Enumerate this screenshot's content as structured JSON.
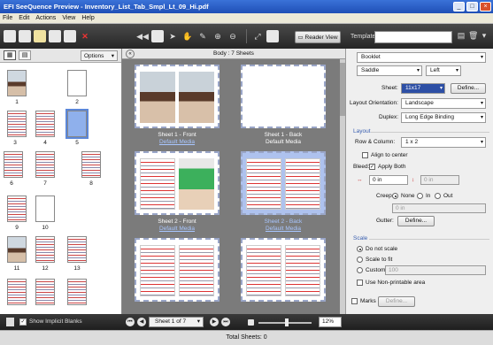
{
  "window": {
    "title": "EFI SeeQuence Preview - Inventory_List_Tab_Smpl_Lt_09_Hi.pdf",
    "min": "_",
    "max": "□",
    "close": "×"
  },
  "menu": [
    "File",
    "Edit",
    "Actions",
    "View",
    "Help"
  ],
  "toolbar": {
    "reader_view": "Reader View",
    "template_label": "Template:",
    "template_value": ""
  },
  "left_pane": {
    "options_label": "Options",
    "thumb_labels": [
      "1",
      "2",
      "3",
      "4",
      "5",
      "6",
      "7",
      "8",
      "9",
      "10",
      "11",
      "12",
      "13"
    ]
  },
  "center": {
    "header": "Body : 7 Sheets",
    "sheets": [
      {
        "name": "Sheet 1 - Front",
        "media": "Default Media",
        "media_link": true
      },
      {
        "name": "Sheet 1 - Back",
        "media": "Default Media",
        "media_link": false
      },
      {
        "name": "Sheet 2 - Front",
        "media": "Default Media",
        "media_link": true
      },
      {
        "name": "Sheet 2 - Back",
        "media": "Default Media",
        "media_link": true
      }
    ]
  },
  "right_pane": {
    "booklet": "Booklet",
    "binding": "Saddle",
    "side": "Left",
    "sheet_label": "Sheet:",
    "sheet_value": "11x17",
    "define_label": "Define...",
    "orientation_label": "Layout Orientation:",
    "orientation_value": "Landscape",
    "duplex_label": "Duplex:",
    "duplex_value": "Long Edge Binding",
    "layout_section": "Layout",
    "rowcol_label": "Row & Column:",
    "rowcol_value": "1 x 2",
    "align_center": "Align to center",
    "bleed_label": "Bleed:",
    "apply_both": "Apply Both",
    "bleed_value1": "0 in",
    "bleed_value2": "0 in",
    "creep_label": "Creep:",
    "creep_none": "None",
    "creep_in": "In",
    "creep_out": "Out",
    "creep_value": "0 in",
    "gutter_label": "Gutter:",
    "gutter_define": "Define...",
    "scale_section": "Scale",
    "scale_none": "Do not scale",
    "scale_fit": "Scale to fit",
    "scale_custom": "Custom",
    "scale_custom_value": "100",
    "non_printable": "Use Non-printable area",
    "marks_label": "Marks",
    "marks_define": "Define..."
  },
  "bottom": {
    "show_blanks": "Show Implicit Blanks",
    "sheet_nav": "Sheet 1 of 7",
    "zoom": "12%"
  },
  "status": {
    "total": "Total Sheets: 0"
  }
}
